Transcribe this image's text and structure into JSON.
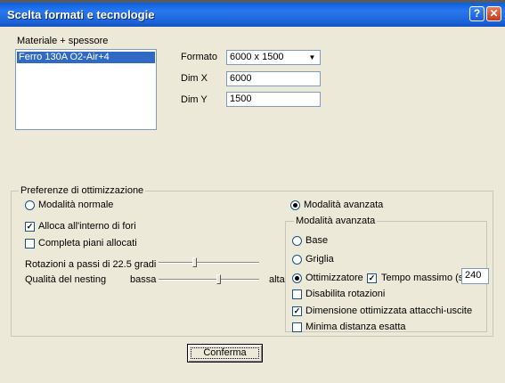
{
  "window": {
    "title": "Scelta formati e tecnologie",
    "help_glyph": "?",
    "close_glyph": "✕"
  },
  "material": {
    "label": "Materiale + spessore",
    "items": [
      "Ferro 130A O2-Air+4"
    ]
  },
  "formato": {
    "label": "Formato",
    "value": "6000 x 1500",
    "arrow": "▼"
  },
  "dimx": {
    "label": "Dim X",
    "value": "6000"
  },
  "dimy": {
    "label": "Dim Y",
    "value": "1500"
  },
  "prefs": {
    "title": "Preferenze di ottimizzazione",
    "mode_normal": {
      "label": "Modalità normale",
      "selected": false
    },
    "mode_advanced": {
      "label": "Modalità avanzata",
      "selected": true
    },
    "alloca": {
      "label": "Alloca all'interno di fori",
      "checked": true
    },
    "completa": {
      "label": "Completa piani allocati",
      "checked": false
    },
    "rotazioni": {
      "label": "Rotazioni a passi di 22.5 gradi",
      "level": 0.35
    },
    "qualita": {
      "label": "Qualità del nesting",
      "low": "bassa",
      "high": "alta",
      "level": 0.6
    },
    "advanced": {
      "title": "Modalità avanzata",
      "base": {
        "label": "Base",
        "selected": false
      },
      "griglia": {
        "label": "Griglia",
        "selected": false
      },
      "ottimizzatore": {
        "label": "Ottimizzatore",
        "selected": true
      },
      "tempo": {
        "label": "Tempo massimo (sec)",
        "checked": true,
        "value": "240"
      },
      "disabilita": {
        "label": "Disabilita rotazioni",
        "checked": false
      },
      "dimensione": {
        "label": "Dimensione ottimizzata attacchi-uscite",
        "checked": true
      },
      "minima": {
        "label": "Minima distanza esatta",
        "checked": false
      }
    }
  },
  "confirm": {
    "label": "Conferma"
  },
  "check_glyph": "✓"
}
